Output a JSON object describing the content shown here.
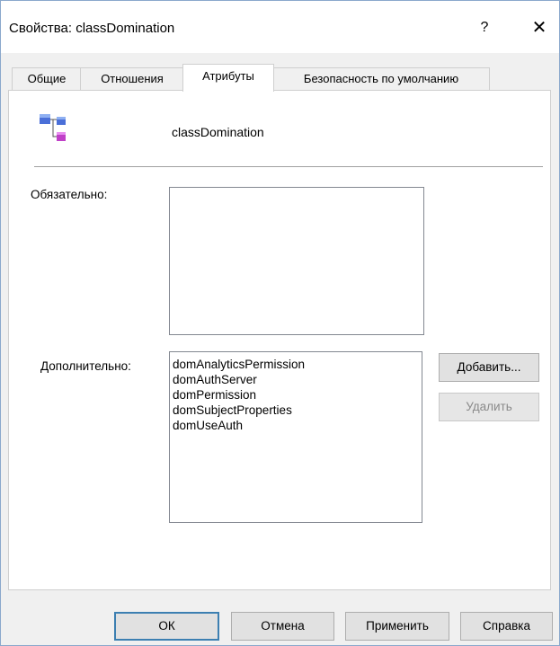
{
  "window": {
    "title": "Свойства: classDomination",
    "help_glyph": "?",
    "close_glyph": "✕"
  },
  "tabs": [
    {
      "label": "Общие"
    },
    {
      "label": "Отношения"
    },
    {
      "label": "Атрибуты"
    },
    {
      "label": "Безопасность по умолчанию"
    }
  ],
  "active_tab": "Атрибуты",
  "header": {
    "icon": "class-hierarchy-icon",
    "class_name": "classDomination"
  },
  "mandatory": {
    "label": "Обязательно:",
    "items": []
  },
  "optional": {
    "label": "Дополнительно:",
    "items": [
      "domAnalyticsPermission",
      "domAuthServer",
      "domPermission",
      "domSubjectProperties",
      "domUseAuth"
    ],
    "add_label": "Добавить...",
    "remove_label": "Удалить"
  },
  "footer": {
    "ok_label": "ОК",
    "cancel_label": "Отмена",
    "apply_label": "Применить",
    "help_label": "Справка"
  },
  "colors": {
    "accent": "#3c7fb1",
    "icon_blue": "#4a6fd8",
    "icon_magenta": "#c040c8"
  }
}
